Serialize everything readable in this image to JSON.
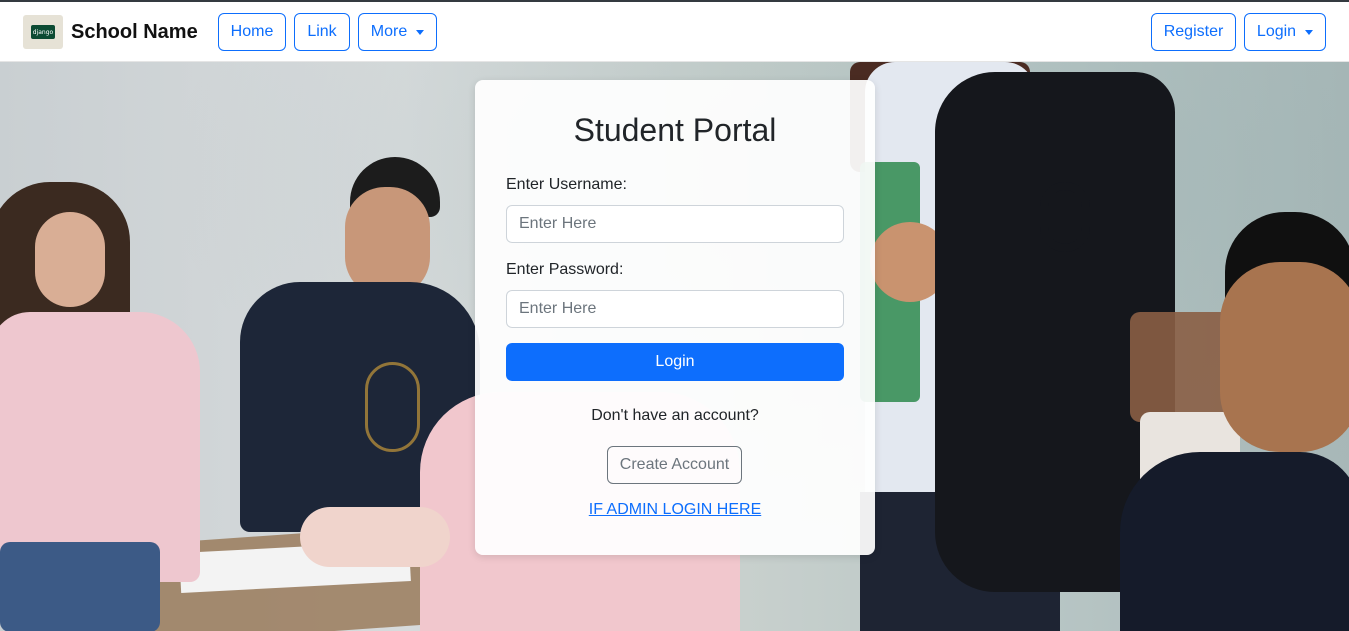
{
  "navbar": {
    "brand_name": "School Name",
    "logo_text": "django",
    "left_links": [
      "Home",
      "Link",
      "More"
    ],
    "right_links": [
      "Register",
      "Login"
    ]
  },
  "login_card": {
    "title": "Student Portal",
    "username_label": "Enter Username:",
    "username_placeholder": "Enter Here",
    "password_label": "Enter Password:",
    "password_placeholder": "Enter Here",
    "login_button": "Login",
    "no_account_text": "Don't have an account?",
    "create_account_button": "Create Account",
    "admin_link": "IF ADMIN LOGIN HERE"
  },
  "colors": {
    "primary": "#0d6efd",
    "secondary": "#6c757d",
    "topline": "#343a40"
  }
}
